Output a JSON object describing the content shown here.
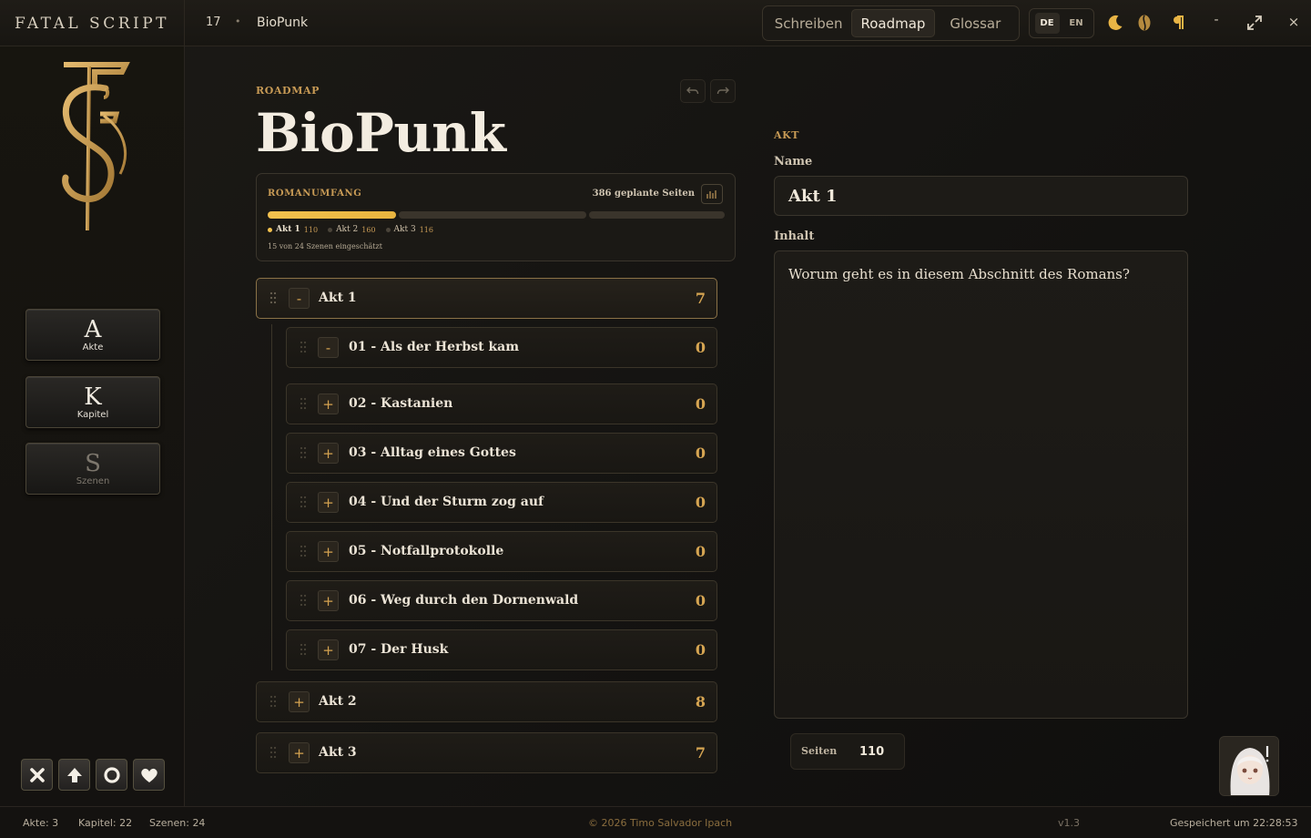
{
  "app": {
    "brand": "FATAL SCRIPT",
    "project_number": "17",
    "project_separator": "•",
    "project_name": "BioPunk"
  },
  "mode_tabs": [
    {
      "label": "Schreiben",
      "active": false
    },
    {
      "label": "Roadmap",
      "active": true
    },
    {
      "label": "Glossar",
      "active": false
    }
  ],
  "languages": [
    {
      "label": "DE",
      "active": true
    },
    {
      "label": "EN",
      "active": false
    }
  ],
  "toolbar_icons": [
    "moon-icon",
    "coffee-bean-icon",
    "pilcrow-icon"
  ],
  "window_controls": {
    "minimize": "-",
    "close": "×"
  },
  "sidebar": {
    "nav": [
      {
        "letter": "A",
        "label": "Akte",
        "enabled": true
      },
      {
        "letter": "K",
        "label": "Kapitel",
        "enabled": true
      },
      {
        "letter": "S",
        "label": "Szenen",
        "enabled": false
      }
    ],
    "bottom_icons": [
      "close-icon",
      "arrow-up-icon",
      "circle-icon",
      "heart-icon"
    ]
  },
  "roadmap": {
    "kicker": "ROADMAP",
    "title": "BioPunk",
    "scope": {
      "label": "ROMANUMFANG",
      "planned_pages": "386 geplante Seiten",
      "acts": [
        {
          "name": "Akt 1",
          "pages": "110",
          "share": 110,
          "active": true
        },
        {
          "name": "Akt 2",
          "pages": "160",
          "share": 160,
          "active": false
        },
        {
          "name": "Akt 3",
          "pages": "116",
          "share": 116,
          "active": false
        }
      ],
      "estimate_note": "15 von 24 Szenen eingeschätzt"
    },
    "tree": {
      "akt1": {
        "toggle": "-",
        "label": "Akt 1",
        "count": "7"
      },
      "chapters": [
        {
          "toggle": "-",
          "label": "01 - Als der Herbst kam",
          "count": "0"
        },
        {
          "toggle": "+",
          "label": "02 - Kastanien",
          "count": "0"
        },
        {
          "toggle": "+",
          "label": "03 - Alltag eines Gottes",
          "count": "0"
        },
        {
          "toggle": "+",
          "label": "04 - Und der Sturm zog auf",
          "count": "0"
        },
        {
          "toggle": "+",
          "label": "05 - Notfallprotokolle",
          "count": "0"
        },
        {
          "toggle": "+",
          "label": "06 - Weg durch den Dornenwald",
          "count": "0"
        },
        {
          "toggle": "+",
          "label": "07 - Der Husk",
          "count": "0"
        }
      ],
      "akt2": {
        "toggle": "+",
        "label": "Akt 2",
        "count": "8"
      },
      "akt3": {
        "toggle": "+",
        "label": "Akt 3",
        "count": "7"
      }
    }
  },
  "details": {
    "kicker": "AKT",
    "name_label": "Name",
    "name_value": "Akt 1",
    "content_label": "Inhalt",
    "content_placeholder": "Worum geht es in diesem Abschnitt des Romans?",
    "pages_label": "Seiten",
    "pages_value": "110"
  },
  "status": {
    "acts": "Akte: 3",
    "chapters": "Kapitel: 22",
    "scenes": "Szenen: 24",
    "copyright": "© 2026 Timo Salvador Ipach",
    "version": "v1.3",
    "saved": "Gespeichert um 22:28:53"
  },
  "colors": {
    "accent": "#c79a55",
    "progress": "#f2c14e",
    "background": "#141311"
  }
}
